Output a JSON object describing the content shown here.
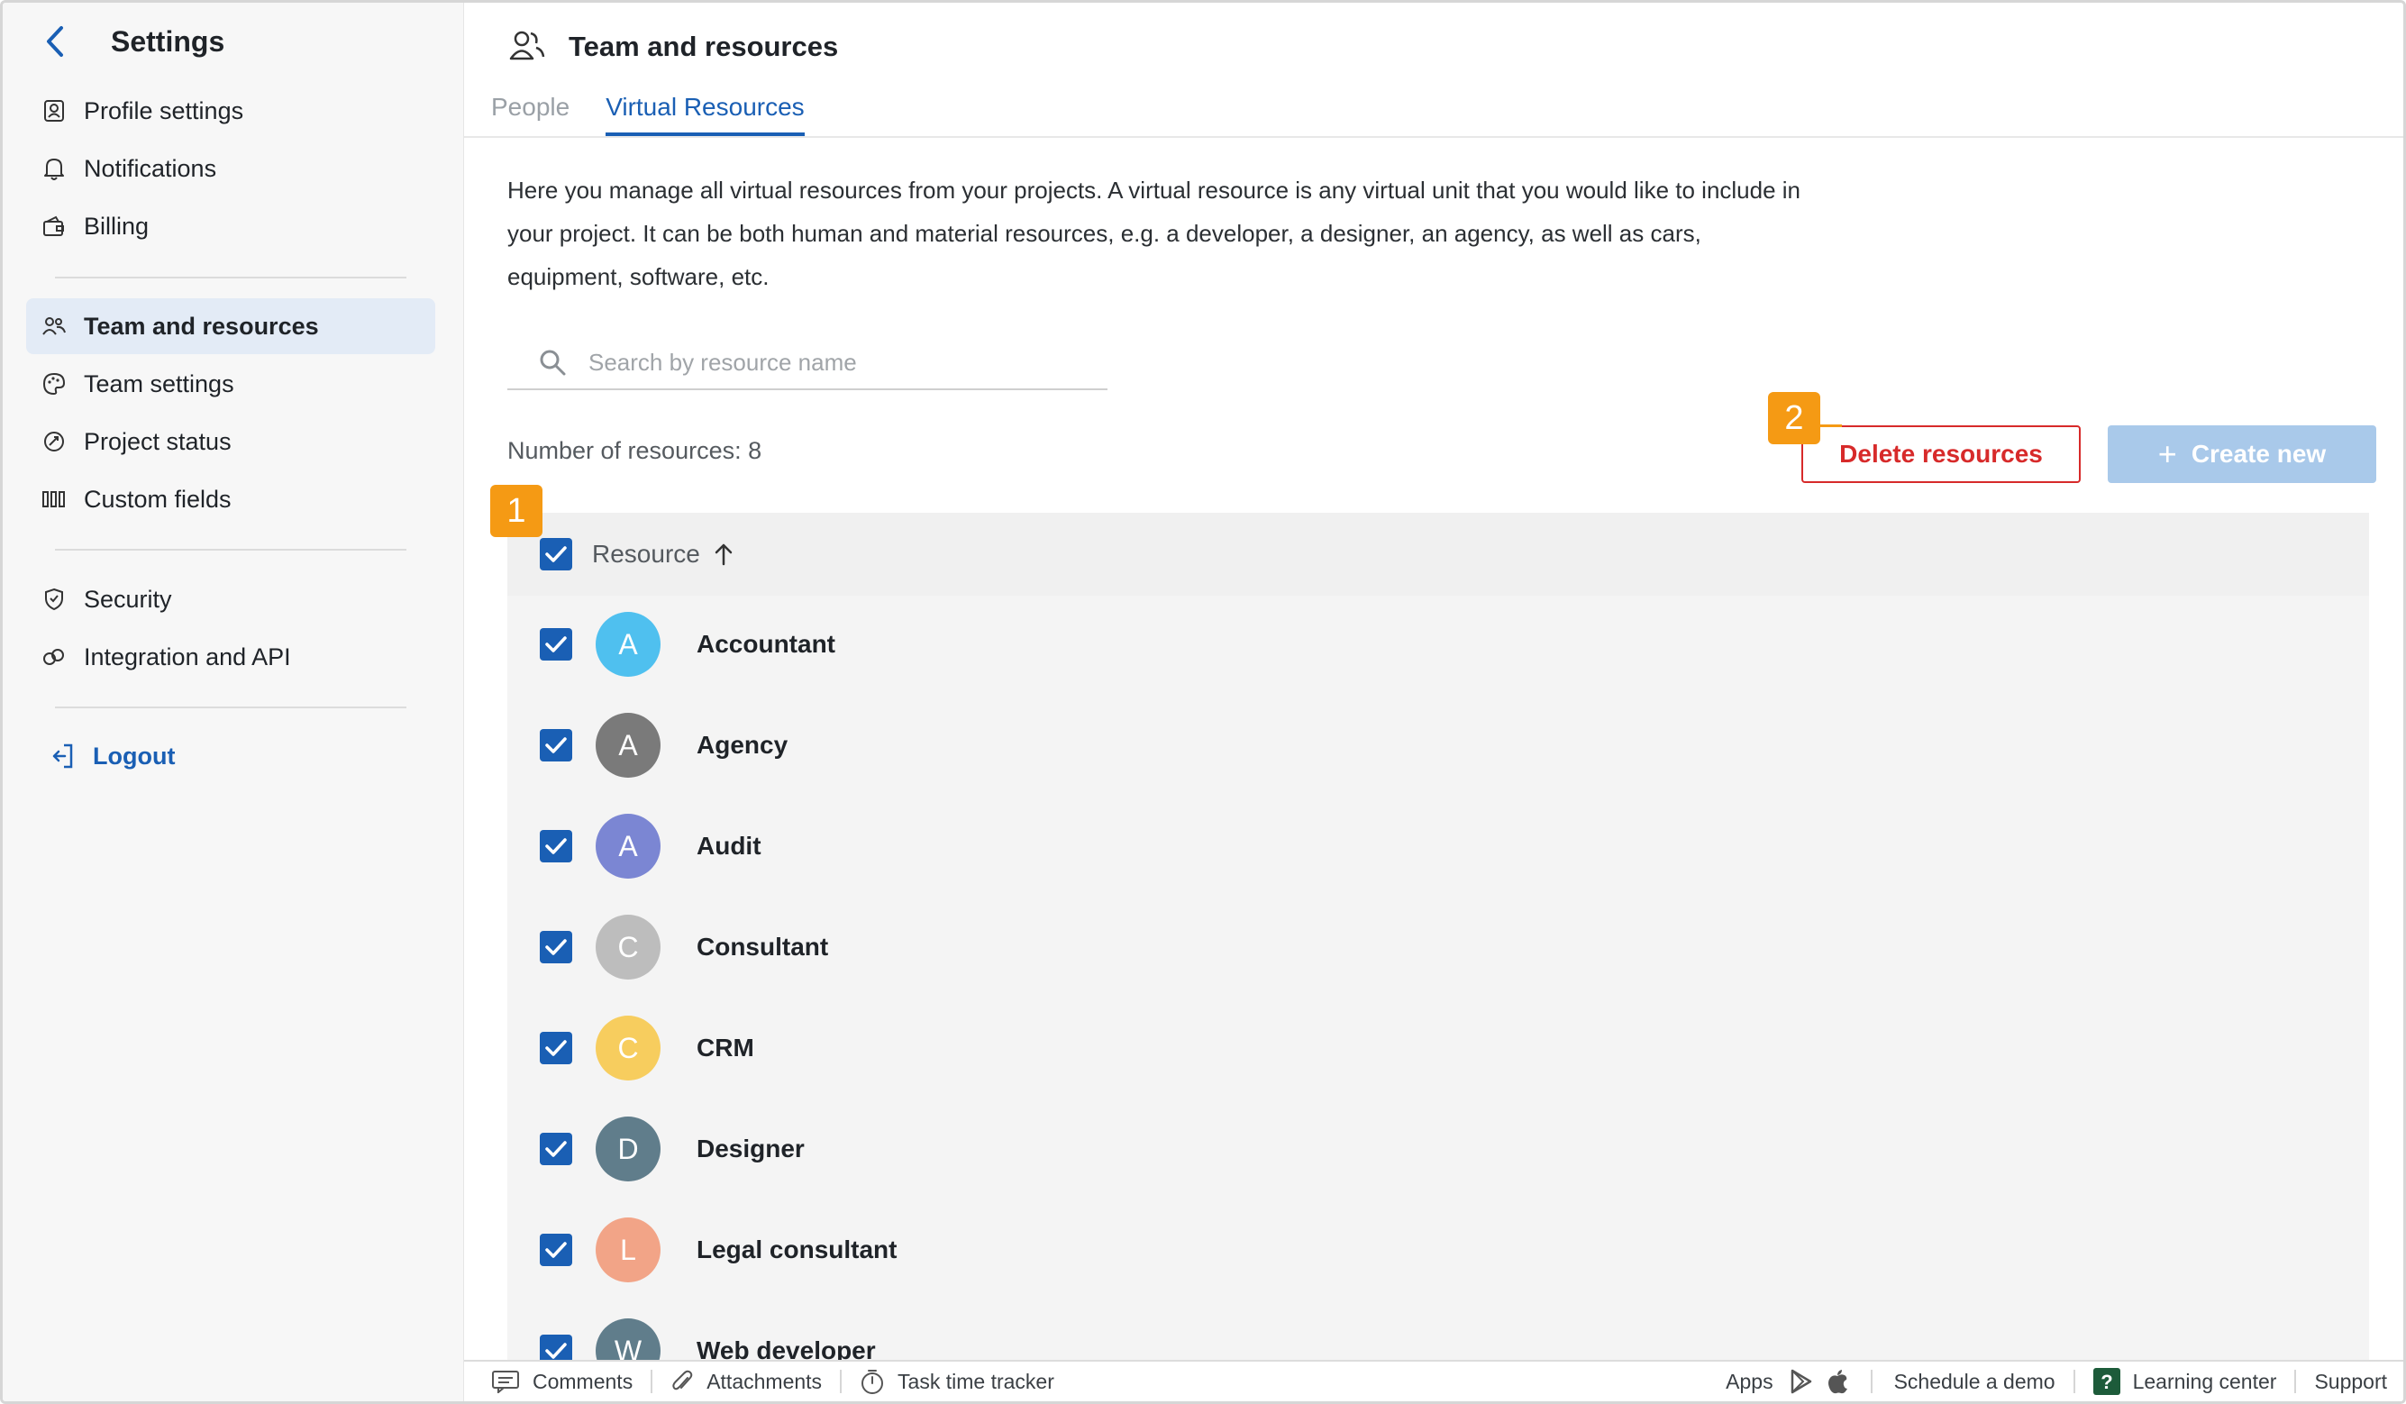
{
  "sidebar": {
    "title": "Settings",
    "items": [
      {
        "label": "Profile settings",
        "icon": "profile-icon"
      },
      {
        "label": "Notifications",
        "icon": "bell-icon"
      },
      {
        "label": "Billing",
        "icon": "wallet-icon"
      },
      {
        "label": "Team and resources",
        "icon": "team-icon"
      },
      {
        "label": "Team settings",
        "icon": "palette-icon"
      },
      {
        "label": "Project status",
        "icon": "status-icon"
      },
      {
        "label": "Custom fields",
        "icon": "columns-icon"
      },
      {
        "label": "Security",
        "icon": "shield-icon"
      },
      {
        "label": "Integration and API",
        "icon": "link-icon"
      }
    ],
    "logout": "Logout"
  },
  "header": {
    "title": "Team and resources",
    "tabs": [
      {
        "label": "People"
      },
      {
        "label": "Virtual Resources"
      }
    ]
  },
  "main": {
    "description": "Here you manage all virtual resources from your projects. A virtual resource is any virtual unit that you would like to include in your project. It can be both human and material resources, e.g. a developer, a designer, an agency, as well as cars, equipment, software, etc.",
    "search_placeholder": "Search by resource name",
    "count_label": "Number of resources: 8",
    "delete_label": "Delete resources",
    "create_label": "Create new",
    "column_header": "Resource",
    "resources": [
      {
        "initial": "A",
        "name": "Accountant",
        "color": "#4fc0ef"
      },
      {
        "initial": "A",
        "name": "Agency",
        "color": "#7a7a7a"
      },
      {
        "initial": "A",
        "name": "Audit",
        "color": "#7b86d3"
      },
      {
        "initial": "C",
        "name": "Consultant",
        "color": "#bdbdbd"
      },
      {
        "initial": "C",
        "name": "CRM",
        "color": "#f7cd5e"
      },
      {
        "initial": "D",
        "name": "Designer",
        "color": "#607d8b"
      },
      {
        "initial": "L",
        "name": "Legal consultant",
        "color": "#f2a487"
      },
      {
        "initial": "W",
        "name": "Web developer",
        "color": "#607d8b"
      }
    ]
  },
  "annotations": {
    "one": "1",
    "two": "2"
  },
  "footer": {
    "comments": "Comments",
    "attachments": "Attachments",
    "tracker": "Task time tracker",
    "apps": "Apps",
    "demo": "Schedule a demo",
    "learning": "Learning center",
    "support": "Support"
  },
  "colors": {
    "accent": "#1a5fb4",
    "danger": "#d72a2a",
    "badge": "#f59a14"
  }
}
